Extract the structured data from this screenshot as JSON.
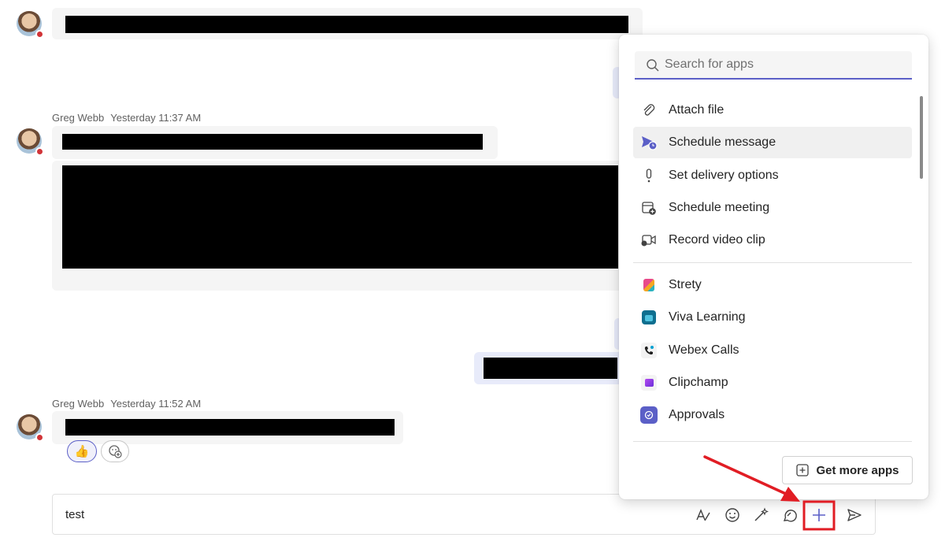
{
  "messages": [
    {
      "sender": "Greg Webb",
      "time": "Yesterday 11:37 AM"
    },
    {
      "sender": "Greg Webb",
      "time": "Yesterday 11:52 AM"
    }
  ],
  "reactions": [
    {
      "icon": "thumbs-up",
      "emoji": "👍"
    },
    {
      "icon": "add-reaction"
    }
  ],
  "compose": {
    "value": "test"
  },
  "compose_tools": [
    "format-icon",
    "emoji-icon",
    "copilot-icon",
    "loop-icon",
    "add-icon",
    "send-icon"
  ],
  "apps_menu": {
    "search_placeholder": "Search for apps",
    "actions": [
      {
        "label": "Attach file",
        "icon": "paperclip-icon"
      },
      {
        "label": "Schedule message",
        "icon": "schedule-send-icon"
      },
      {
        "label": "Set delivery options",
        "icon": "priority-icon"
      },
      {
        "label": "Schedule meeting",
        "icon": "calendar-add-icon"
      },
      {
        "label": "Record video clip",
        "icon": "video-clip-icon"
      }
    ],
    "apps": [
      {
        "label": "Strety",
        "color": "#e84a8a"
      },
      {
        "label": "Viva Learning",
        "color": "#0f6f8f"
      },
      {
        "label": "Webex Calls",
        "color": "#1d1d1d"
      },
      {
        "label": "Clipchamp",
        "color": "#7b3fe4"
      },
      {
        "label": "Approvals",
        "color": "#5b5fc7"
      }
    ],
    "get_more_label": "Get more apps"
  },
  "colors": {
    "accent": "#5b5fc7",
    "annotation": "#e11d24"
  }
}
